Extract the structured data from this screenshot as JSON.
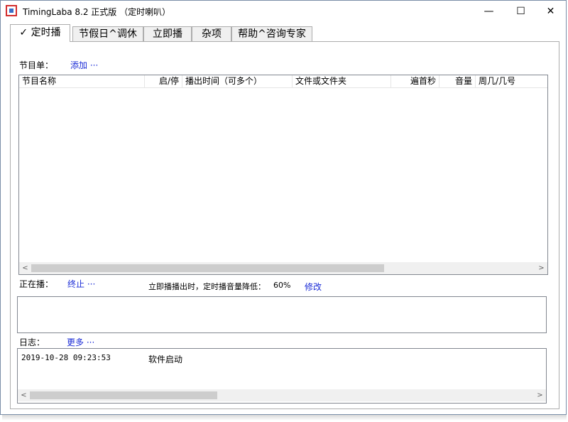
{
  "window": {
    "title": "TimingLaba 8.2 正式版 （定时喇叭）",
    "minimize": "—",
    "maximize": "☐",
    "close": "✕"
  },
  "tabs": [
    {
      "label": "✓ 定时播",
      "active": true
    },
    {
      "label": "节假日^调休",
      "active": false
    },
    {
      "label": "立即播",
      "active": false
    },
    {
      "label": "杂项",
      "active": false
    },
    {
      "label": "帮助^咨询专家",
      "active": false
    }
  ],
  "programs": {
    "label": "节目单：",
    "add_link": "添加 ···",
    "columns": [
      "节目名称",
      "启/停",
      "播出时间（可多个）",
      "文件或文件夹",
      "遍首秒",
      "音量",
      "周几/几号"
    ],
    "rows": []
  },
  "playing": {
    "label": "正在播：",
    "stop_link": "终止 ···",
    "note": "立即播播出时，定时播音量降低：",
    "percent": "60%",
    "modify_link": "修改"
  },
  "log": {
    "label": "日志：",
    "more_link": "更多 ···",
    "entries": [
      {
        "time": "2019-10-28 09:23:53",
        "message": "软件启动"
      }
    ]
  },
  "scrollbar": {
    "left": "<",
    "right": ">"
  },
  "colors": {
    "link": "#1a2bd6",
    "border": "#828790",
    "scroll_thumb": "#cdcdcd"
  }
}
